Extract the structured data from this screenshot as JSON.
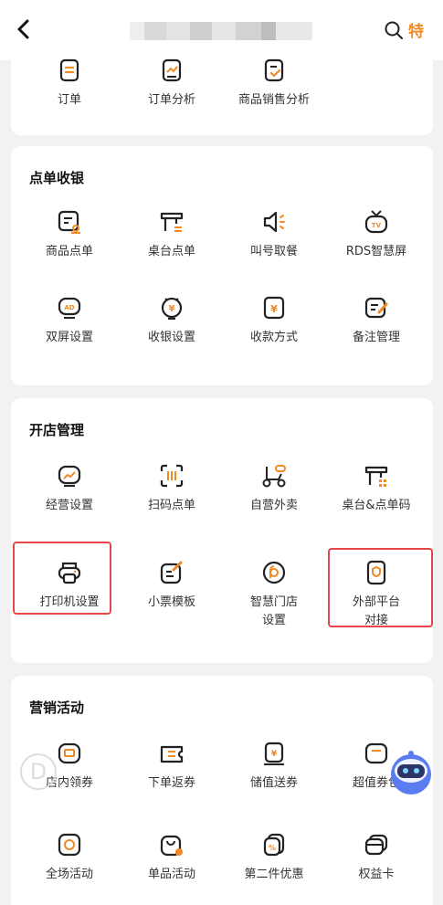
{
  "topbar": {
    "back_icon": "chevron-left-icon",
    "search_icon": "search-icon",
    "special_label": "特"
  },
  "top_items": [
    {
      "label": "订单",
      "icon": "list-icon"
    },
    {
      "label": "订单分析",
      "icon": "analytics-icon"
    },
    {
      "label": "商品销售分析",
      "icon": "sales-icon"
    }
  ],
  "sections": [
    {
      "title": "点单收银",
      "items": [
        {
          "label": "商品点单",
          "icon": "product-order-icon"
        },
        {
          "label": "桌台点单",
          "icon": "table-order-icon"
        },
        {
          "label": "叫号取餐",
          "icon": "speaker-icon"
        },
        {
          "label": "RDS智慧屏",
          "icon": "tv-icon"
        },
        {
          "label": "双屏设置",
          "icon": "ad-screen-icon"
        },
        {
          "label": "收银设置",
          "icon": "cashier-icon"
        },
        {
          "label": "收款方式",
          "icon": "yen-icon"
        },
        {
          "label": "备注管理",
          "icon": "note-edit-icon"
        }
      ]
    },
    {
      "title": "开店管理",
      "items": [
        {
          "label": "经营设置",
          "icon": "chart-monitor-icon"
        },
        {
          "label": "扫码点单",
          "icon": "scan-icon"
        },
        {
          "label": "自营外卖",
          "icon": "scooter-icon"
        },
        {
          "label": "桌台&点单码",
          "icon": "table-qr-icon"
        },
        {
          "label": "打印机设置",
          "icon": "printer-icon"
        },
        {
          "label": "小票模板",
          "icon": "receipt-template-icon"
        },
        {
          "label": "智慧门店设置",
          "icon": "smart-store-icon"
        },
        {
          "label": "外部平台对接",
          "icon": "external-platform-icon"
        }
      ]
    },
    {
      "title": "营销活动",
      "items": [
        {
          "label": "店内领券",
          "icon": "coupon-icon"
        },
        {
          "label": "下单返券",
          "icon": "return-coupon-icon"
        },
        {
          "label": "储值送券",
          "icon": "stored-value-icon"
        },
        {
          "label": "超值券包",
          "icon": "coupon-pack-icon"
        },
        {
          "label": "全场活动",
          "icon": "store-activity-icon"
        },
        {
          "label": "单品活动",
          "icon": "item-activity-icon"
        },
        {
          "label": "第二件优惠",
          "icon": "second-discount-icon"
        },
        {
          "label": "权益卡",
          "icon": "benefit-card-icon"
        }
      ]
    }
  ],
  "colors": {
    "accent": "#f08a24",
    "highlight": "#e8474a",
    "icon_stroke": "#222222"
  }
}
